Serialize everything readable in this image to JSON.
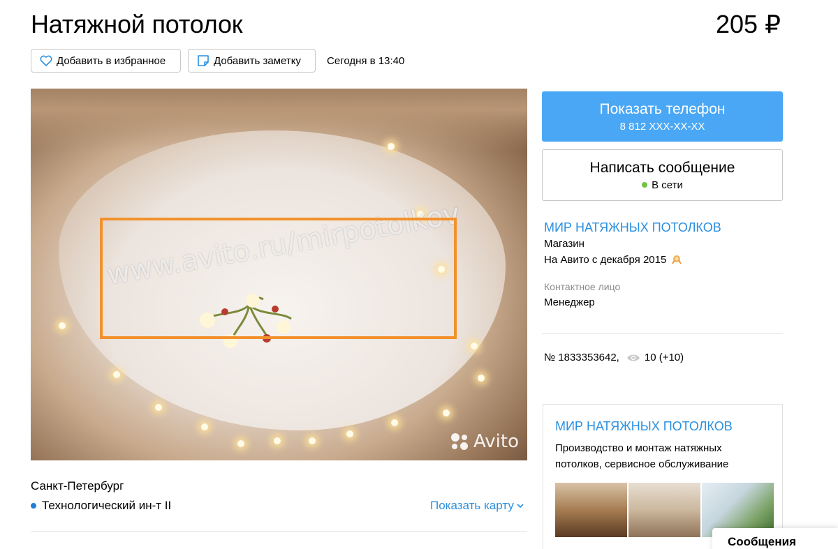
{
  "listing": {
    "title": "Натяжной потолок",
    "price": "205 ₽",
    "favorite_label": "Добавить в избранное",
    "note_label": "Добавить заметку",
    "date": "Сегодня в 13:40",
    "photo_watermark": "www.avito.ru/mirpotolkov",
    "photo_brand": "Avito"
  },
  "location": {
    "city": "Санкт-Петербург",
    "metro": "Технологический ин-т II",
    "map_link": "Показать карту"
  },
  "contact": {
    "phone_button": "Показать телефон",
    "phone_masked": "8 812 XXX-XX-XX",
    "message_button": "Написать сообщение",
    "online_status": "В сети"
  },
  "seller": {
    "name": "МИР НАТЯЖНЫХ ПОТОЛКОВ",
    "type": "Магазин",
    "since": "На Авито с декабря 2015",
    "contact_label": "Контактное лицо",
    "contact_name": "Менеджер"
  },
  "ad_meta": {
    "number": "№ 1833353642,",
    "views": "10 (+10)"
  },
  "shop": {
    "name": "МИР НАТЯЖНЫХ ПОТОЛКОВ",
    "description": "Производство и монтаж натяжных потолков, сервисное обслуживание"
  },
  "footer": {
    "messages_tab": "Сообщения"
  },
  "colors": {
    "link": "#2a8fe0",
    "primary_button": "#4aa7f5",
    "online": "#72c143",
    "highlight_box": "#f2912c"
  }
}
